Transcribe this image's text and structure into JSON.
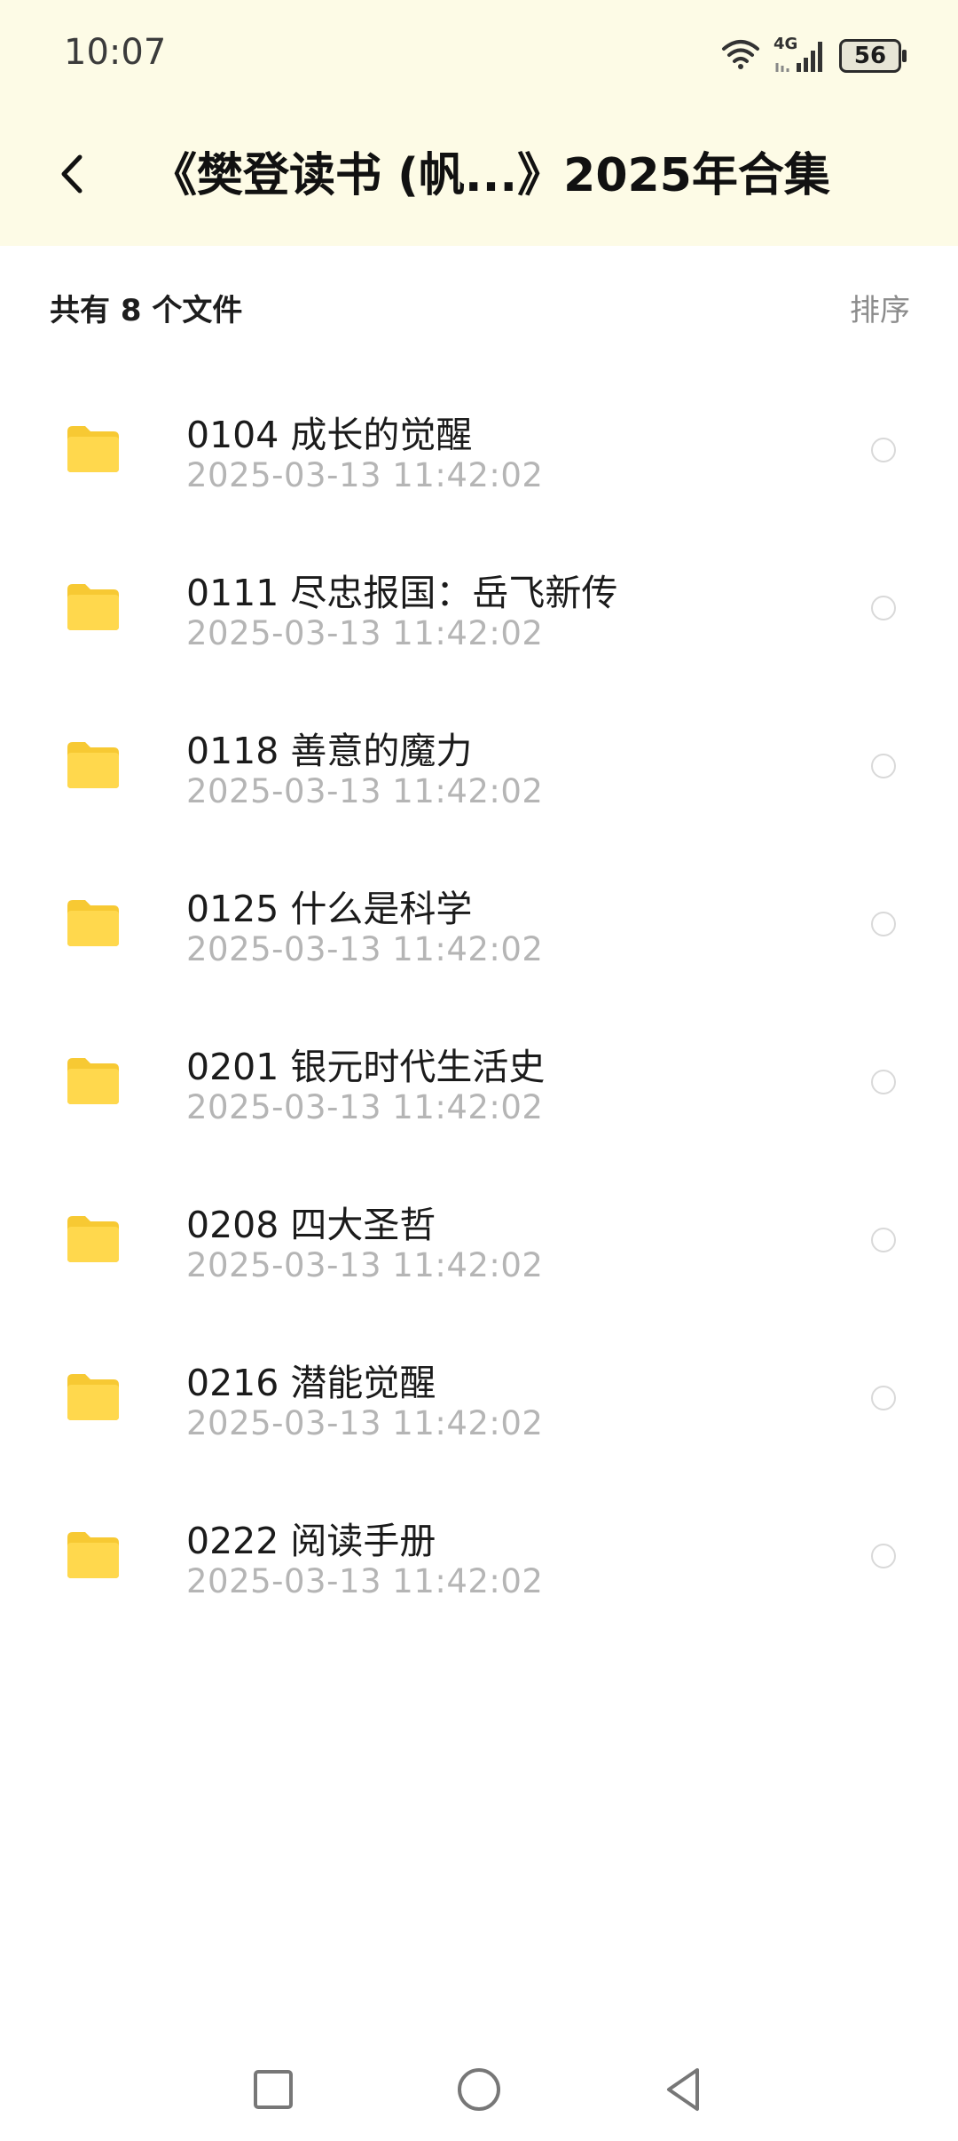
{
  "status_bar": {
    "time": "10:07",
    "network": "4G",
    "battery": "56"
  },
  "header": {
    "title": "《樊登读书 (帆...》2025年合集"
  },
  "summary": {
    "count_label": "共有 8 个文件",
    "sort_label": "排序"
  },
  "files": [
    {
      "name": "0104 成长的觉醒",
      "date": "2025-03-13  11:42:02"
    },
    {
      "name": "0111 尽忠报国：岳飞新传",
      "date": "2025-03-13  11:42:02"
    },
    {
      "name": "0118 善意的魔力",
      "date": "2025-03-13  11:42:02"
    },
    {
      "name": "0125 什么是科学",
      "date": "2025-03-13  11:42:02"
    },
    {
      "name": "0201 银元时代生活史",
      "date": "2025-03-13  11:42:02"
    },
    {
      "name": "0208 四大圣哲",
      "date": "2025-03-13  11:42:02"
    },
    {
      "name": "0216 潜能觉醒",
      "date": "2025-03-13  11:42:02"
    },
    {
      "name": "0222 阅读手册",
      "date": "2025-03-13  11:42:02"
    }
  ],
  "colors": {
    "header_bg": "#fdfbe6",
    "folder": "#ffd84d",
    "folder_tab": "#f7c933",
    "date_text": "#b5b5b5"
  },
  "icons": [
    "back-arrow-icon",
    "wifi-icon",
    "signal-icon",
    "battery-icon",
    "folder-icon",
    "radio-circle-icon",
    "nav-recents-icon",
    "nav-home-icon",
    "nav-back-icon"
  ]
}
